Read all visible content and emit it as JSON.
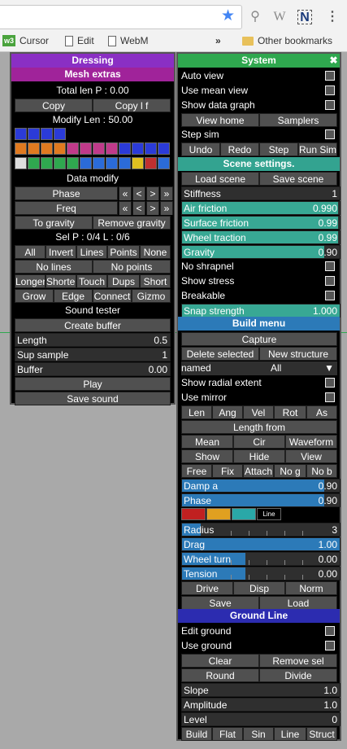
{
  "browser": {
    "bookmarks": [
      "Cursor",
      "Edit",
      "WebM"
    ],
    "overflow": "»",
    "other": "Other bookmarks"
  },
  "dressing": {
    "title": "Dressing",
    "mesh_extras": "Mesh extras",
    "total_len": "Total len P : 0.00",
    "copy": "Copy",
    "copy_lf": "Copy l f",
    "modify_len": "Modify Len : 50.00",
    "data_modify": "Data modify",
    "phase": "Phase",
    "freq": "Freq",
    "to_gravity": "To gravity",
    "remove_gravity": "Remove gravity",
    "sel": "Sel P : 0/4 L : 0/6",
    "sel_buttons": [
      "All",
      "Invert",
      "Lines",
      "Points",
      "None"
    ],
    "no_lines": "No lines",
    "no_points": "No points",
    "ops1": [
      "Longer",
      "Shorter",
      "Touch",
      "Dups",
      "Short"
    ],
    "ops2": [
      "Grow",
      "Edge",
      "Connect",
      "Gizmo"
    ],
    "sound_tester": "Sound tester",
    "create_buffer": "Create buffer",
    "length": {
      "label": "Length",
      "value": "0.5"
    },
    "sup_sample": {
      "label": "Sup sample",
      "value": "1"
    },
    "buffer": {
      "label": "Buffer",
      "value": "0.00"
    },
    "play": "Play",
    "save_sound": "Save sound",
    "arrows": [
      "«",
      "<",
      ">",
      "»"
    ]
  },
  "system": {
    "title": "System",
    "close": "✖",
    "checks": [
      "Auto view",
      "Use mean view",
      "Show data graph"
    ],
    "view_home": "View home",
    "samplers": "Samplers",
    "step_sim": "Step sim",
    "undo_row": [
      "Undo",
      "Redo",
      "Step",
      "Run Sim"
    ],
    "scene_settings": "Scene settings.",
    "load_scene": "Load scene",
    "save_scene": "Save scene",
    "sliders": [
      {
        "label": "Stiffness",
        "value": "1",
        "fill": 0.0
      },
      {
        "label": "Air friction",
        "value": "0.990",
        "fill": 0.99
      },
      {
        "label": "Surface friction",
        "value": "0.99",
        "fill": 0.99
      },
      {
        "label": "Wheel traction",
        "value": "0.99",
        "fill": 0.99
      },
      {
        "label": "Gravity",
        "value": "0.90",
        "fill": 0.9
      }
    ],
    "checks2": [
      "No shrapnel",
      "Show stress",
      "Breakable"
    ],
    "snap": {
      "label": "Snap strength",
      "value": "1.000",
      "fill": 1.0
    },
    "build_menu": "Build menu",
    "capture": "Capture",
    "delete_selected": "Delete selected",
    "new_structure": "New structure",
    "named": "named",
    "named_value": "All",
    "show_radial": "Show radial extent",
    "use_mirror": "Use mirror",
    "len_row": [
      "Len",
      "Ang",
      "Vel",
      "Rot",
      "As"
    ],
    "length_from": "Length from",
    "mean_row": [
      "Mean",
      "Cir",
      "Waveform"
    ],
    "show_row": [
      "Show",
      "Hide",
      "View"
    ],
    "free_row": [
      "Free",
      "Fix",
      "Attach",
      "No g",
      "No b"
    ],
    "sliders2": [
      {
        "label": "Damp a",
        "value": "0.90",
        "fill": 0.9
      },
      {
        "label": "Phase",
        "value": "0.90",
        "fill": 0.9
      }
    ],
    "sliders3": [
      {
        "label": "Radius",
        "value": "3",
        "fill": 0.12
      },
      {
        "label": "Drag",
        "value": "1.00",
        "fill": 1.0
      },
      {
        "label": "Wheel turn",
        "value": "0.00",
        "fill": 0.4
      },
      {
        "label": "Tension",
        "value": "0.00",
        "fill": 0.4
      }
    ],
    "drive_row": [
      "Drive",
      "Disp",
      "Norm"
    ],
    "save": "Save",
    "load": "Load",
    "ground_line": "Ground Line",
    "edit_ground": "Edit ground",
    "use_ground": "Use ground",
    "clear": "Clear",
    "remove_sel": "Remove sel",
    "round": "Round",
    "divide": "Divide",
    "sliders4": [
      {
        "label": "Slope",
        "value": "1.0",
        "fill": 0.0
      },
      {
        "label": "Amplitude",
        "value": "1.0",
        "fill": 0.0
      },
      {
        "label": "Level",
        "value": "0",
        "fill": 0.0
      }
    ],
    "build_row": [
      "Build",
      "Flat",
      "Sin",
      "Line",
      "Struct"
    ],
    "line_label": "Line"
  },
  "colors": {
    "dressing_header": "#8a2fc4",
    "mesh_header": "#a0239a",
    "system_header": "#2fa84f",
    "scene_header": "#33a390",
    "build_header": "#2c7ab8",
    "ground_header": "#2c2cb0",
    "slider_blue": "#2c7ab8",
    "slider_teal": "#38a894"
  }
}
